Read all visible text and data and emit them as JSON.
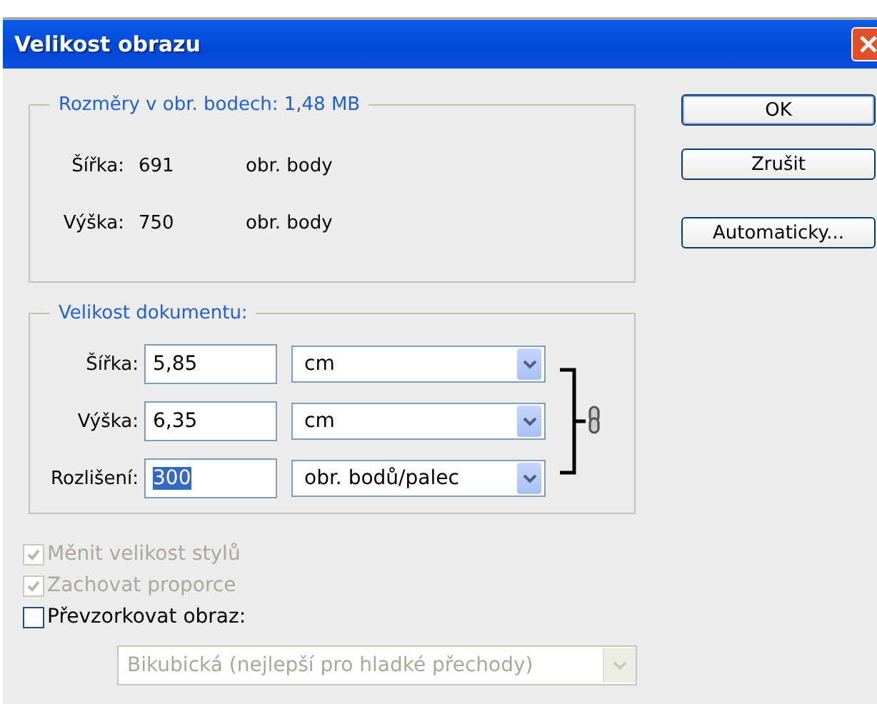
{
  "window": {
    "title": "Velikost obrazu"
  },
  "pixel_dimensions": {
    "legend": "Rozměry v obr. bodech:  1,48 MB",
    "rows": [
      {
        "label": "Šířka:",
        "value": "691",
        "unit": "obr. body"
      },
      {
        "label": "Výška:",
        "value": "750",
        "unit": "obr. body"
      }
    ]
  },
  "buttons": [
    {
      "label": "OK",
      "default": true
    },
    {
      "label": "Zrušit",
      "default": false
    },
    {
      "label": "Automaticky...",
      "default": false
    }
  ],
  "document_size": {
    "legend": "Velikost dokumentu:",
    "rows": [
      {
        "label": "Šířka:",
        "value": "5,85",
        "value_selected": false,
        "unit": "cm"
      },
      {
        "label": "Výška:",
        "value": "6,35",
        "value_selected": false,
        "unit": "cm"
      },
      {
        "label": "Rozlišení:",
        "value": "300",
        "value_selected": true,
        "unit": "obr. bodů/palec"
      }
    ]
  },
  "checkboxes": [
    {
      "label": "Měnit velikost stylů",
      "checked": true,
      "disabled": true
    },
    {
      "label": "Zachovat proporce",
      "checked": true,
      "disabled": true
    },
    {
      "label": "Převzorkovat obraz:",
      "checked": false,
      "disabled": false
    }
  ],
  "resample_method": {
    "value": "Bikubická (nejlepší pro hladké přechody)",
    "disabled": true
  }
}
